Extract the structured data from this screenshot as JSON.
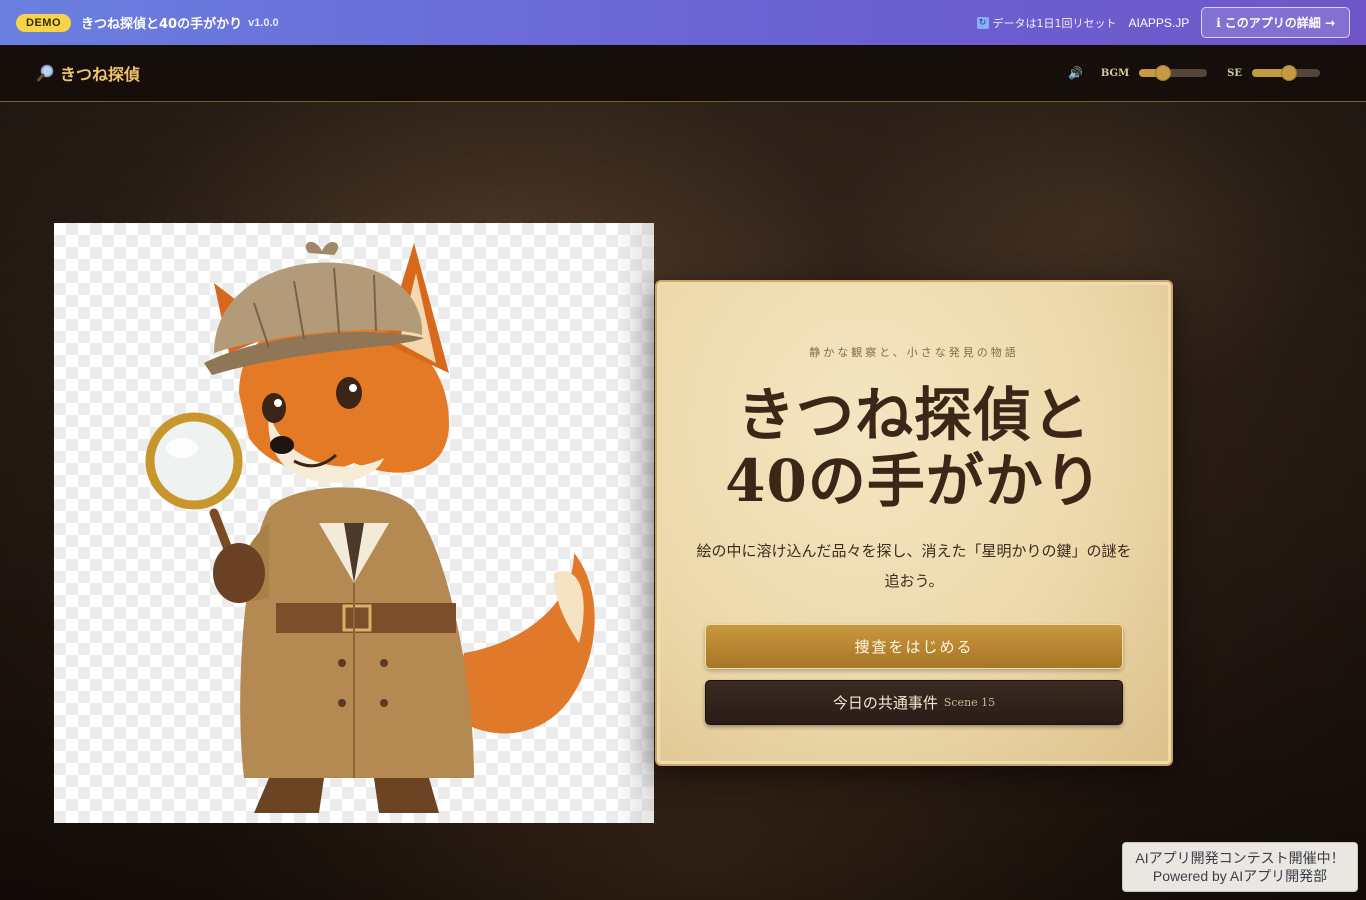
{
  "demobar": {
    "badge": "DEMO",
    "title": "きつね探偵と40の手がかり",
    "version": "v1.0.0",
    "reset_note": "データは1日1回リセット",
    "site_link": "AIAPPS.JP",
    "detail_button": "このアプリの詳細 →",
    "colors": {
      "bar_start": "#6a7fe0",
      "bar_end": "#6e56c8",
      "badge": "#f6d44a"
    }
  },
  "header": {
    "brand": "きつね探偵",
    "bgm_label": "BGM",
    "se_label": "SE",
    "bgm_level": 0.35,
    "se_level": 0.55,
    "accent": "#f0c46a"
  },
  "card": {
    "tagline": "静かな観察と、小さな発見の物語",
    "title_line1": "きつね探偵と",
    "title_line2": "40の手がかり",
    "description": "絵の中に溶け込んだ品々を探し、消えた「星明かりの鍵」の謎を追おう。",
    "start_button": "捜査をはじめる",
    "daily_button": "今日の共通事件",
    "daily_scene": "Scene 15"
  },
  "toast": {
    "line1": "AIアプリ開発コンテスト開催中！",
    "line2": "Powered by AIアプリ開発部"
  }
}
